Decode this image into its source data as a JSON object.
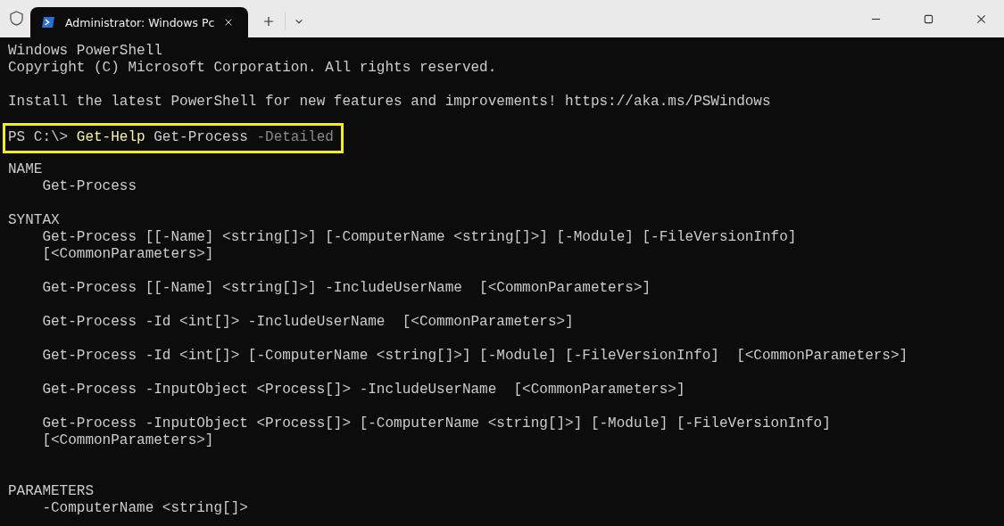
{
  "window": {
    "tab": {
      "title": "Administrator: Windows Pc",
      "selected": true
    }
  },
  "terminal": {
    "lines": [
      {
        "kind": "text",
        "segments": [
          {
            "kind": "plain",
            "text": "Windows PowerShell"
          }
        ]
      },
      {
        "kind": "text",
        "segments": [
          {
            "kind": "plain",
            "text": "Copyright (C) Microsoft Corporation. All rights reserved."
          }
        ]
      },
      {
        "kind": "blank"
      },
      {
        "kind": "text",
        "segments": [
          {
            "kind": "plain",
            "text": "Install the latest PowerShell for new features and improvements! https://aka.ms/PSWindows"
          }
        ]
      },
      {
        "kind": "blank"
      },
      {
        "kind": "text",
        "highlighted": true,
        "segments": [
          {
            "kind": "plain",
            "text": "PS C:\\> "
          },
          {
            "kind": "command",
            "text": "Get-Help"
          },
          {
            "kind": "plain",
            "text": " Get-Process "
          },
          {
            "kind": "parameter",
            "text": "-Detailed"
          }
        ]
      },
      {
        "kind": "blank"
      },
      {
        "kind": "text",
        "segments": [
          {
            "kind": "plain",
            "text": "NAME"
          }
        ]
      },
      {
        "kind": "text",
        "segments": [
          {
            "kind": "plain",
            "text": "    Get-Process"
          }
        ]
      },
      {
        "kind": "blank"
      },
      {
        "kind": "text",
        "segments": [
          {
            "kind": "plain",
            "text": "SYNTAX"
          }
        ]
      },
      {
        "kind": "text",
        "segments": [
          {
            "kind": "plain",
            "text": "    Get-Process [[-Name] <string[]>] [-ComputerName <string[]>] [-Module] [-FileVersionInfo]"
          }
        ]
      },
      {
        "kind": "text",
        "segments": [
          {
            "kind": "plain",
            "text": "    [<CommonParameters>]"
          }
        ]
      },
      {
        "kind": "blank"
      },
      {
        "kind": "text",
        "segments": [
          {
            "kind": "plain",
            "text": "    Get-Process [[-Name] <string[]>] -IncludeUserName  [<CommonParameters>]"
          }
        ]
      },
      {
        "kind": "blank"
      },
      {
        "kind": "text",
        "segments": [
          {
            "kind": "plain",
            "text": "    Get-Process -Id <int[]> -IncludeUserName  [<CommonParameters>]"
          }
        ]
      },
      {
        "kind": "blank"
      },
      {
        "kind": "text",
        "segments": [
          {
            "kind": "plain",
            "text": "    Get-Process -Id <int[]> [-ComputerName <string[]>] [-Module] [-FileVersionInfo]  [<CommonParameters>]"
          }
        ]
      },
      {
        "kind": "blank"
      },
      {
        "kind": "text",
        "segments": [
          {
            "kind": "plain",
            "text": "    Get-Process -InputObject <Process[]> -IncludeUserName  [<CommonParameters>]"
          }
        ]
      },
      {
        "kind": "blank"
      },
      {
        "kind": "text",
        "segments": [
          {
            "kind": "plain",
            "text": "    Get-Process -InputObject <Process[]> [-ComputerName <string[]>] [-Module] [-FileVersionInfo]"
          }
        ]
      },
      {
        "kind": "text",
        "segments": [
          {
            "kind": "plain",
            "text": "    [<CommonParameters>]"
          }
        ]
      },
      {
        "kind": "blank"
      },
      {
        "kind": "blank"
      },
      {
        "kind": "text",
        "segments": [
          {
            "kind": "plain",
            "text": "PARAMETERS"
          }
        ]
      },
      {
        "kind": "text",
        "segments": [
          {
            "kind": "plain",
            "text": "    -ComputerName <string[]>"
          }
        ]
      }
    ]
  }
}
